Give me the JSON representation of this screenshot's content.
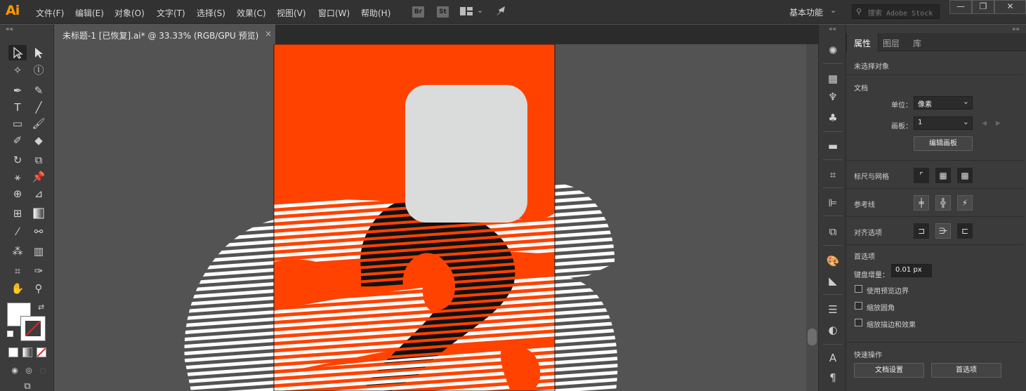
{
  "app": {
    "logo": "Ai"
  },
  "menubar": {
    "items": [
      "文件(F)",
      "编辑(E)",
      "对象(O)",
      "文字(T)",
      "选择(S)",
      "效果(C)",
      "视图(V)",
      "窗口(W)",
      "帮助(H)"
    ],
    "bridge_label": "Br",
    "stock_label": "St",
    "workspace": "基本功能",
    "search_placeholder": "搜索 Adobe Stock"
  },
  "window_controls": {
    "minimize": "—",
    "restore": "❐",
    "close": "✕"
  },
  "document": {
    "tab_title": "未标题-1 [已恢复].ai* @ 33.33% (RGB/GPU 预览)",
    "close": "×"
  },
  "artboard": {
    "background": "#ff4200",
    "card_color": "#dadcdc",
    "stripe_color": "#ffffff",
    "dark_color": "#111111"
  },
  "properties": {
    "tabs": [
      "属性",
      "图层",
      "库"
    ],
    "no_selection": "未选择对象",
    "doc_section": "文档",
    "units_label": "单位：",
    "units_value": "像素",
    "artboard_label": "画板：",
    "artboard_value": "1",
    "edit_artboards": "编辑画板",
    "rulers_grids": "标尺与网格",
    "guides": "参考线",
    "snap_options": "对齐选项",
    "preferences_section": "首选项",
    "keyboard_increment_label": "键盘增量：",
    "keyboard_increment_value": "0.01 px",
    "checkboxes": [
      "使用预览边界",
      "缩放圆角",
      "缩放描边和效果"
    ],
    "quick_actions": "快速操作",
    "doc_setup_button": "文档设置",
    "preferences_button": "首选项"
  },
  "colors": {
    "accent_logo": "#ff9a00",
    "artboard_orange": "#ff4200"
  }
}
